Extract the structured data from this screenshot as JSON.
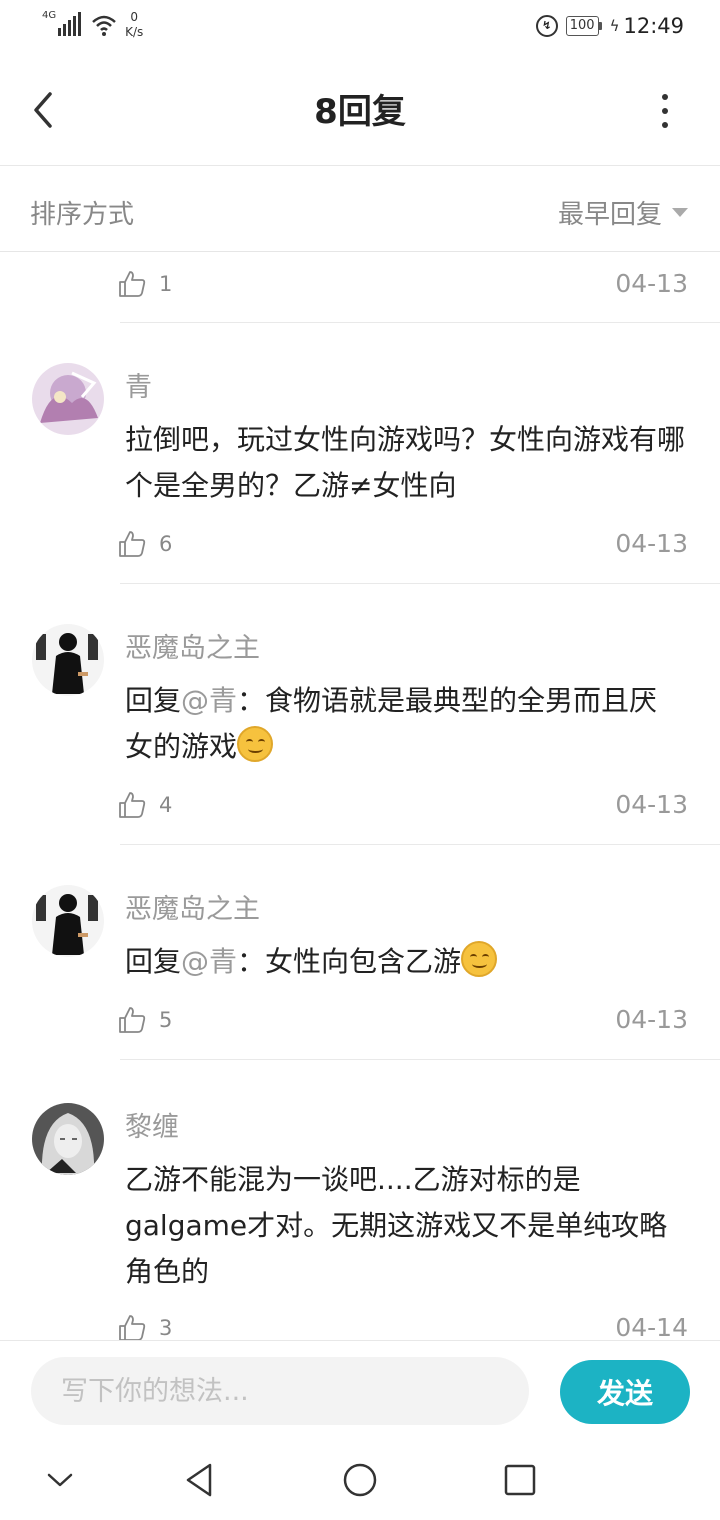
{
  "status_bar": {
    "network": "4G",
    "speed_value": "0",
    "speed_unit": "K/s",
    "battery": "100",
    "time": "12:49"
  },
  "header": {
    "title": "8回复"
  },
  "sort": {
    "label": "排序方式",
    "value": "最早回复"
  },
  "partial_row": {
    "likes": "1",
    "date": "04-13"
  },
  "comments": [
    {
      "name": "青",
      "text": "拉倒吧，玩过女性向游戏吗？女性向游戏有哪个是全男的？乙游≠女性向",
      "likes": "6",
      "date": "04-13"
    },
    {
      "name": "恶魔岛之主",
      "reply_prefix": "回复",
      "mention": "@青",
      "text": "：食物语就是最典型的全男而且厌女的游戏",
      "likes": "4",
      "date": "04-13"
    },
    {
      "name": "恶魔岛之主",
      "reply_prefix": "回复",
      "mention": "@青",
      "text": "：女性向包含乙游",
      "likes": "5",
      "date": "04-13"
    },
    {
      "name": "黎缠",
      "text": "乙游不能混为一谈吧....乙游对标的是galgame才对。无期这游戏又不是单纯攻略角色的",
      "likes": "3",
      "date": "04-14"
    }
  ],
  "input": {
    "placeholder": "写下你的想法...",
    "send_label": "发送"
  },
  "colors": {
    "accent": "#1cb3c4",
    "muted_text": "#9a9a9a"
  }
}
